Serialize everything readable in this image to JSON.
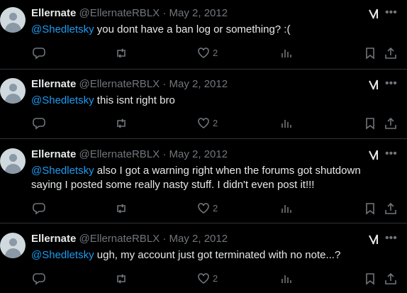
{
  "colors": {
    "background": "#000000",
    "text": "#e7e9ea",
    "muted": "#71767b",
    "link": "#1d9bf0",
    "divider": "#2f3336"
  },
  "icons": {
    "reply": "reply-icon",
    "retweet": "retweet-icon",
    "like": "heart-icon",
    "views": "views-icon",
    "bookmark": "bookmark-icon",
    "share": "share-icon",
    "grok": "grok-icon",
    "more": "more-icon"
  },
  "tweets": [
    {
      "author": "Ellernate",
      "handle": "@EllernateRBLX",
      "separator": "·",
      "date": "May 2, 2012",
      "mention": "@Shedletsky",
      "text": " you dont have a ban log or something? :(",
      "likes": "2"
    },
    {
      "author": "Ellernate",
      "handle": "@EllernateRBLX",
      "separator": "·",
      "date": "May 2, 2012",
      "mention": "@Shedletsky",
      "text": " this isnt right bro",
      "likes": "2"
    },
    {
      "author": "Ellernate",
      "handle": "@EllernateRBLX",
      "separator": "·",
      "date": "May 2, 2012",
      "mention": "@Shedletsky",
      "text": " also I got a warning right when the forums got shutdown saying I posted some really nasty stuff. I didn't even post it!!!",
      "likes": "2"
    },
    {
      "author": "Ellernate",
      "handle": "@EllernateRBLX",
      "separator": "·",
      "date": "May 2, 2012",
      "mention": "@Shedletsky",
      "text": " ugh, my account just got terminated with no note...?",
      "likes": "2"
    }
  ]
}
